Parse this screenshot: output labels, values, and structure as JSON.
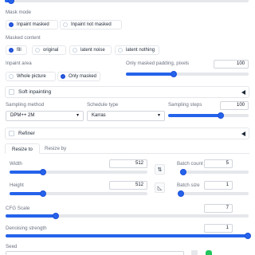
{
  "mask_mode": {
    "label": "Mask mode",
    "options": [
      "Inpaint masked",
      "Inpaint not masked"
    ],
    "selected": 0
  },
  "masked_content": {
    "label": "Masked content",
    "options": [
      "fill",
      "original",
      "latent noise",
      "latent nothing"
    ],
    "selected": 0
  },
  "inpaint_area": {
    "label": "Inpaint area",
    "options": [
      "Whole picture",
      "Only masked"
    ],
    "selected": 1
  },
  "padding": {
    "label": "Only masked padding, pixels",
    "value": "100",
    "fraction": 0.25
  },
  "soft_inpainting": {
    "label": "Soft inpainting"
  },
  "sampling_method": {
    "label": "Sampling method",
    "value": "DPM++ 2M"
  },
  "schedule_type": {
    "label": "Schedule type",
    "value": "Karras"
  },
  "sampling_steps": {
    "label": "Sampling steps",
    "value": "100",
    "fraction": 0.99
  },
  "refiner": {
    "label": "Refiner"
  },
  "resize_tabs": [
    "Resize to",
    "Resize by"
  ],
  "width": {
    "label": "Width",
    "value": "512",
    "fraction": 0.24
  },
  "height": {
    "label": "Height",
    "value": "512",
    "fraction": 0.24
  },
  "batch_count": {
    "label": "Batch count",
    "value": "5",
    "fraction": 0.05
  },
  "batch_size": {
    "label": "Batch size",
    "value": "1",
    "fraction": 0.0
  },
  "cfg_scale": {
    "label": "CFG Scale",
    "value": "7",
    "fraction": 0.2
  },
  "denoising_strength": {
    "label": "Denoising strength",
    "value": "1",
    "fraction": 1.0
  },
  "seed": {
    "label": "Seed"
  },
  "icons": {
    "swap": "swap-arrows-icon",
    "aspect": "aspect-ratio-icon",
    "collapse": "collapse-triangle-icon"
  },
  "colors": {
    "accent": "#2563eb",
    "border": "#e5e7eb",
    "label": "#6b7280"
  }
}
